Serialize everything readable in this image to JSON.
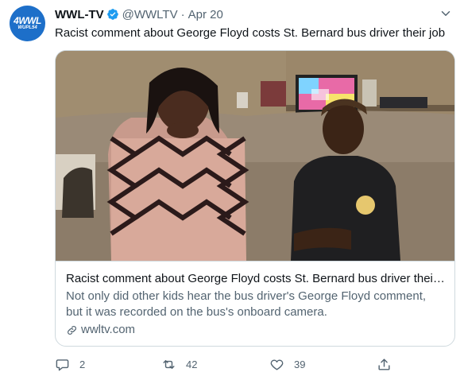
{
  "account": {
    "display_name": "WWL-TV",
    "handle": "@WWLTV",
    "separator": "·",
    "date": "Apr 20",
    "avatar_logo_main": "4WWL",
    "avatar_logo_sub": "WUPL54"
  },
  "tweet": {
    "text": "Racist comment about George Floyd costs St. Bernard bus driver their job"
  },
  "card": {
    "title": "Racist comment about George Floyd costs St. Bernard bus driver their j...",
    "description": "Not only did other kids hear the bus driver's George Floyd comment, but it was recorded on the bus's onboard camera.",
    "domain": "wwltv.com"
  },
  "actions": {
    "replies": "2",
    "retweets": "42",
    "likes": "39"
  },
  "colors": {
    "verified_badge": "#1d9bf0",
    "secondary_text": "#536471",
    "border": "#cfd9de",
    "brand_blue": "#1d6fc9"
  },
  "icons": [
    "verified-icon",
    "more-caret-icon",
    "link-icon",
    "reply-icon",
    "retweet-icon",
    "like-icon",
    "share-icon"
  ]
}
